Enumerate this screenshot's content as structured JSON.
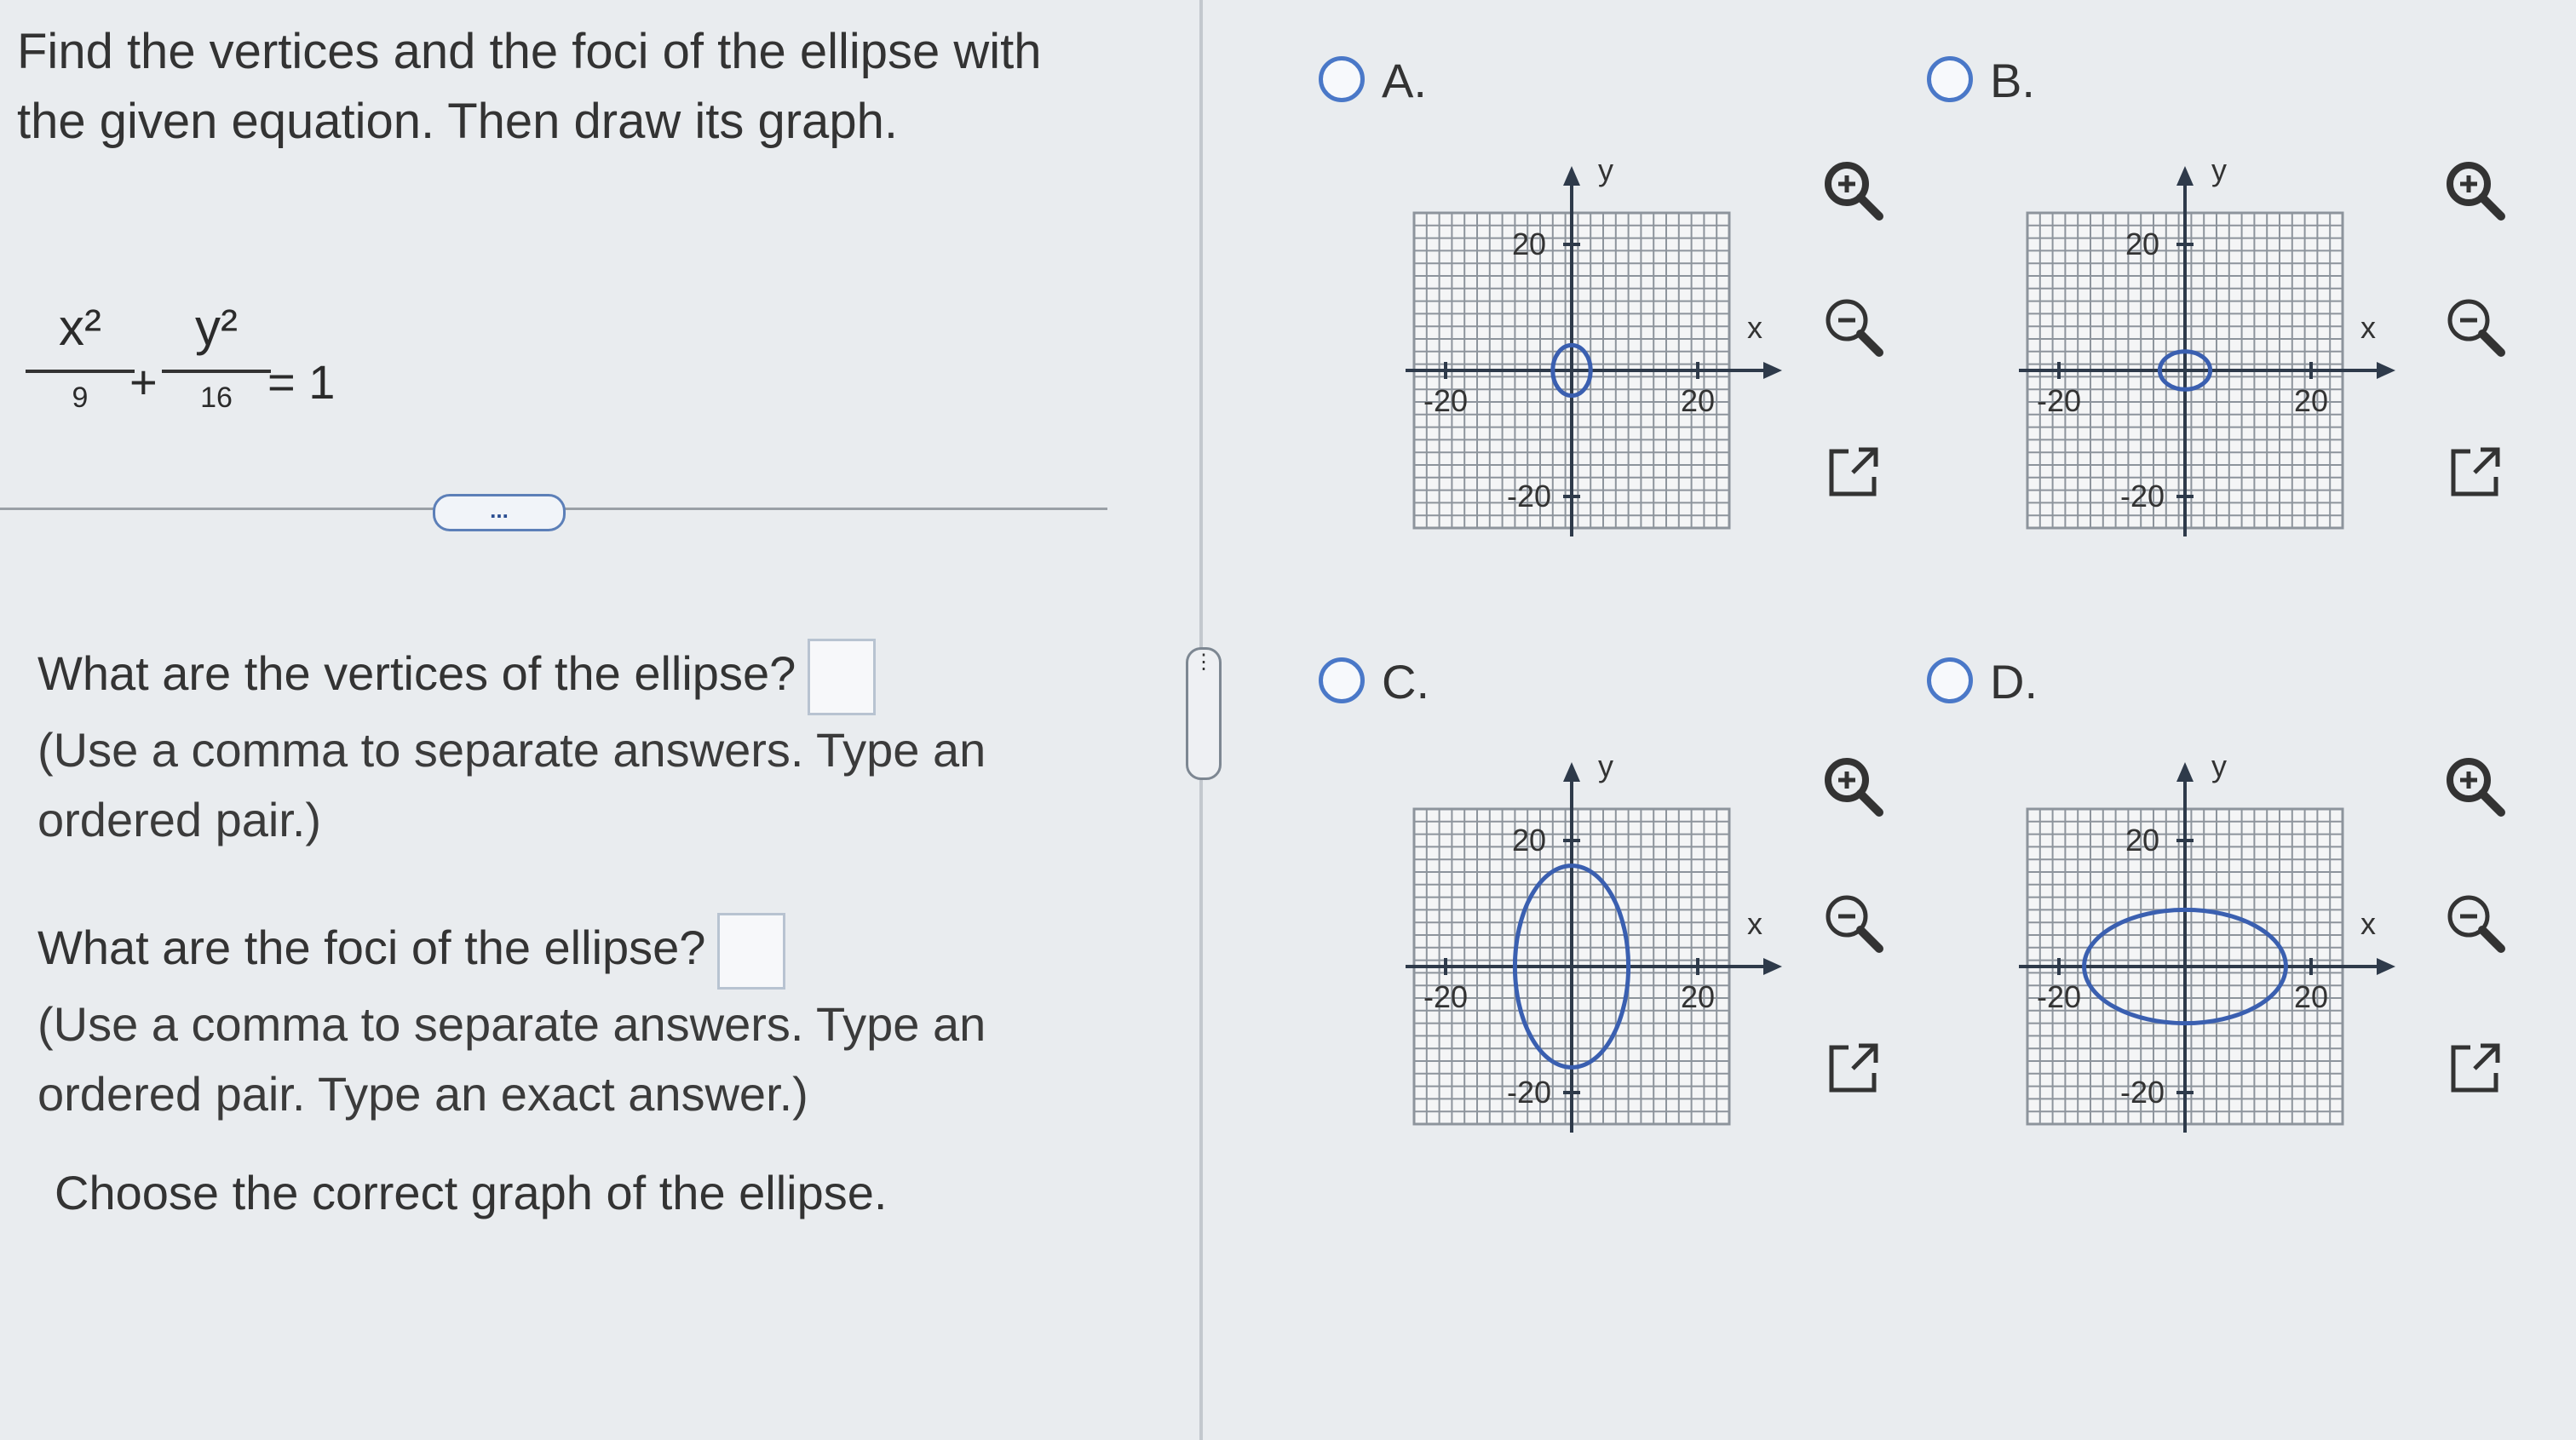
{
  "question": {
    "prompt": "Find the vertices and the foci of the ellipse with the given equation. Then draw its graph.",
    "equation": {
      "term1_num": "x²",
      "term1_den": "9",
      "plus": "+",
      "term2_num": "y²",
      "term2_den": "16",
      "equals": "= 1"
    },
    "expand_label": "...",
    "vertices": {
      "label": "What are the vertices of the ellipse?",
      "hint": "(Use a comma to separate answers. Type an ordered pair.)",
      "value": ""
    },
    "foci": {
      "label": "What are the foci of the ellipse?",
      "hint": "(Use a comma to separate answers. Type an ordered pair. Type an exact answer.)",
      "value": ""
    },
    "choose_text": "Choose the correct graph of the ellipse."
  },
  "splitter_label": "⋮",
  "options": [
    {
      "letter": "A.",
      "x_label": "x",
      "y_label": "y",
      "tick_pos": "20",
      "tick_neg": "-20",
      "rx_units": 3,
      "ry_units": 4,
      "selected": false
    },
    {
      "letter": "B.",
      "x_label": "x",
      "y_label": "y",
      "tick_pos": "20",
      "tick_neg": "-20",
      "rx_units": 4,
      "ry_units": 3,
      "selected": false
    },
    {
      "letter": "C.",
      "x_label": "x",
      "y_label": "y",
      "tick_pos": "20",
      "tick_neg": "-20",
      "rx_units": 9,
      "ry_units": 16,
      "selected": false
    },
    {
      "letter": "D.",
      "x_label": "x",
      "y_label": "y",
      "tick_pos": "20",
      "tick_neg": "-20",
      "rx_units": 16,
      "ry_units": 9,
      "selected": false
    }
  ],
  "icons": {
    "zoom_in": "zoom-in-icon",
    "zoom_out": "zoom-out-icon",
    "open_new": "open-new-window-icon"
  },
  "colors": {
    "radio": "#4a78c8",
    "ellipse": "#3a5fb0",
    "grid": "#8d949c",
    "axis": "#2e3a4a"
  }
}
